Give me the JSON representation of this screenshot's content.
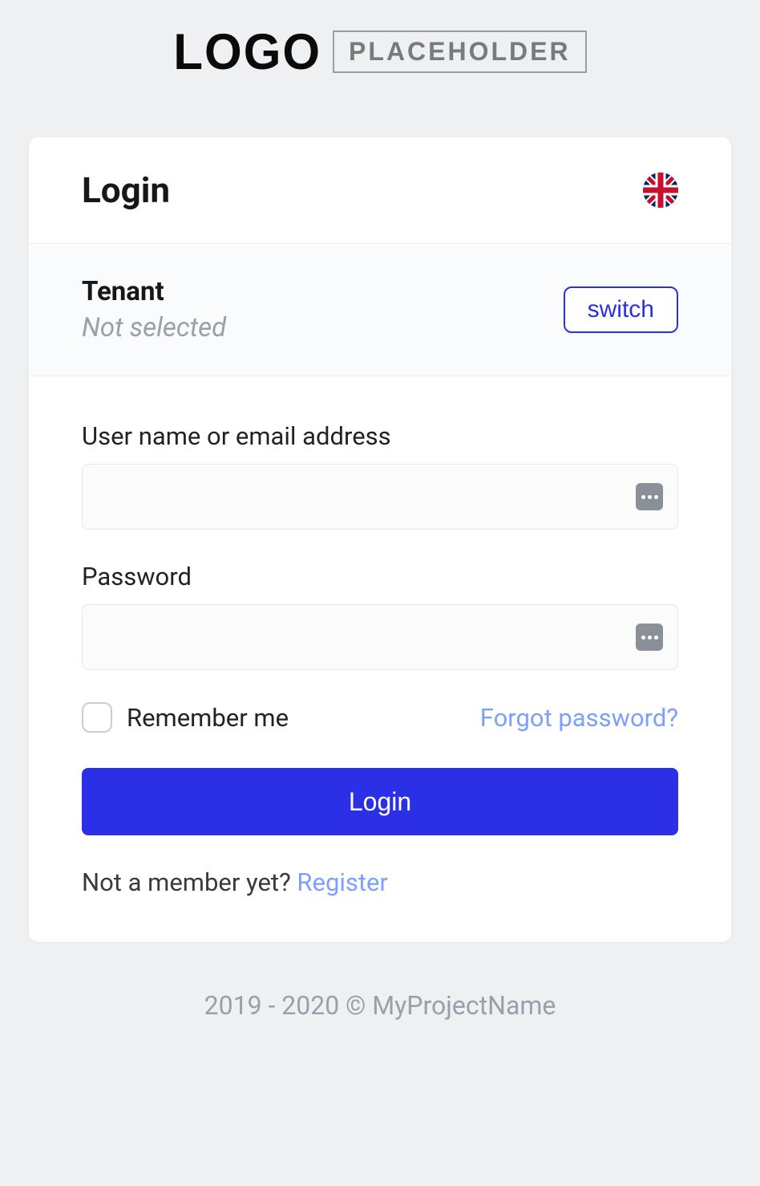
{
  "logo": {
    "main": "LOGO",
    "sub": "PLACEHOLDER"
  },
  "header": {
    "title": "Login"
  },
  "tenant": {
    "label": "Tenant",
    "value": "Not selected",
    "switch_label": "switch"
  },
  "form": {
    "username_label": "User name or email address",
    "password_label": "Password",
    "remember_label": "Remember me",
    "forgot_label": "Forgot password?",
    "login_button": "Login",
    "not_member_text": "Not a member yet? ",
    "register_label": "Register"
  },
  "footer": {
    "text": "2019 - 2020 © MyProjectName"
  }
}
